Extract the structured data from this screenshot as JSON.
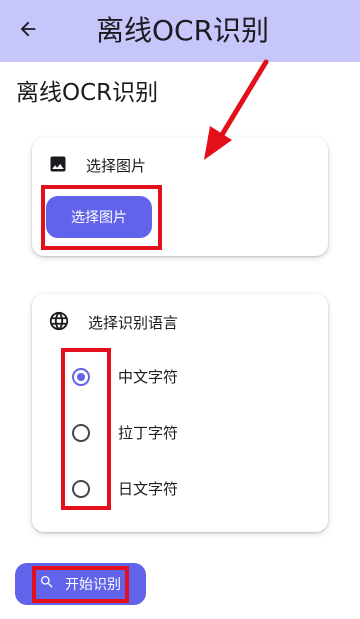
{
  "app_bar": {
    "title": "离线OCR识别",
    "back_icon": "arrow-back-icon",
    "background": "#c6c6fb"
  },
  "page": {
    "title": "离线OCR识别"
  },
  "image_card": {
    "icon": "image-icon",
    "label": "选择图片",
    "button_label": "选择图片"
  },
  "language_card": {
    "icon": "globe-icon",
    "label": "选择识别语言",
    "options": [
      {
        "label": "中文字符",
        "selected": true
      },
      {
        "label": "拉丁字符",
        "selected": false
      },
      {
        "label": "日文字符",
        "selected": false
      }
    ]
  },
  "start_button": {
    "icon": "search-icon",
    "label": "开始识别"
  },
  "colors": {
    "accent": "#6163ea",
    "annotation_red": "#e3101c"
  }
}
